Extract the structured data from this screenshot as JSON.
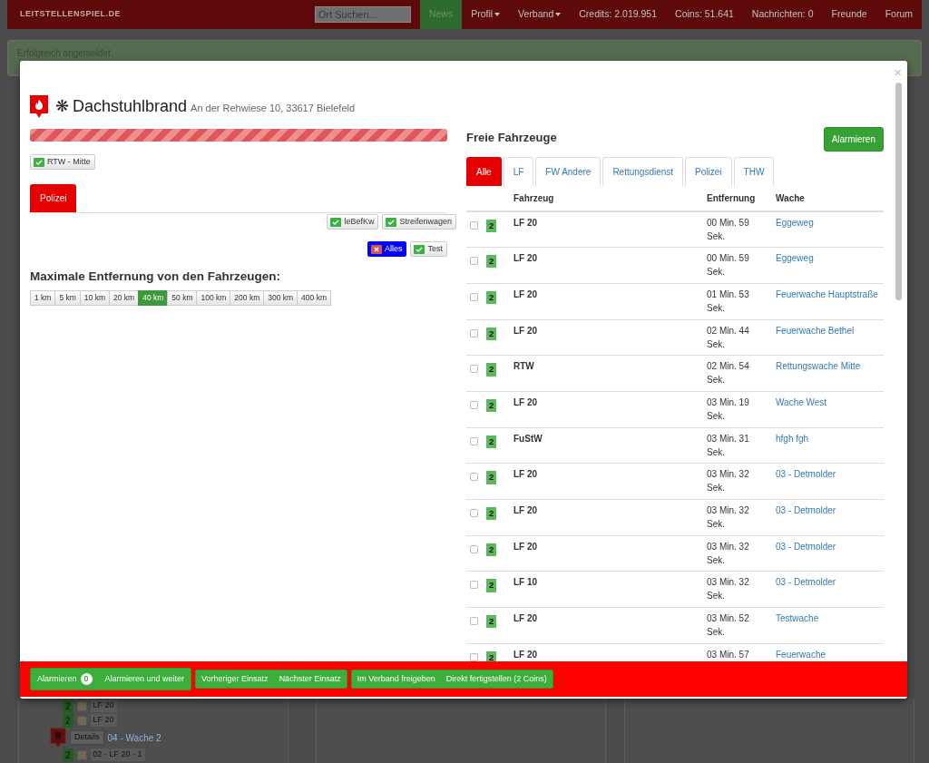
{
  "navbar": {
    "brand": "LEITSTELLENSPIEL.DE",
    "search": {
      "placeholder": "Ort Suchen..."
    },
    "items": [
      {
        "label": "News",
        "selected": true,
        "dropdown": false
      },
      {
        "label": "Profil",
        "selected": false,
        "dropdown": true
      },
      {
        "label": "Verband",
        "selected": false,
        "dropdown": true
      },
      {
        "label": "Credits: 2.019.951",
        "selected": false,
        "dropdown": false
      },
      {
        "label": "Coins: 51.641",
        "selected": false,
        "dropdown": false
      },
      {
        "label": "Nachrichten: 0",
        "selected": false,
        "dropdown": false
      },
      {
        "label": "Freunde",
        "selected": false,
        "dropdown": false
      },
      {
        "label": "Forum",
        "selected": false,
        "dropdown": false
      }
    ]
  },
  "alert": "Erfolgreich angemeldet",
  "background_list": [
    {
      "kind": "vehicle",
      "badge": "2",
      "label": "LF 20"
    },
    {
      "kind": "vehicle",
      "badge": "2",
      "label": "LF 20"
    },
    {
      "kind": "station",
      "button": "Details",
      "label": "04 - Wache 2"
    },
    {
      "kind": "vehicle",
      "badge": "2",
      "label": "02 - LF 20 - 1"
    }
  ],
  "modal": {
    "close": "×",
    "mission": {
      "symbol": "❋",
      "title": "Dachstuhlbrand",
      "address": "An der Rehwiese 10, 33617 Bielefeld",
      "level": 1
    },
    "assigned": [
      {
        "label": "RTW - Mitte",
        "checked": true
      }
    ],
    "requirement_tabs": [
      {
        "label": "Polizei",
        "selected": true
      }
    ],
    "filter_rows": [
      [
        {
          "label": "leBefKw",
          "checked": true,
          "highlighted": false
        },
        {
          "label": "Streifenwagen",
          "checked": true,
          "highlighted": false
        }
      ],
      [
        {
          "label": "Alles",
          "checked": false,
          "highlighted": true
        },
        {
          "label": "Test",
          "checked": true,
          "highlighted": false
        }
      ]
    ],
    "distance": {
      "heading": "Maximale Entfernung von den Fahrzeugen:",
      "options": [
        {
          "label": "1 km",
          "selected": false
        },
        {
          "label": "5 km",
          "selected": false
        },
        {
          "label": "10 km",
          "selected": false
        },
        {
          "label": "20 km",
          "selected": false
        },
        {
          "label": "40 km",
          "selected": true
        },
        {
          "label": "50 km",
          "selected": false
        },
        {
          "label": "100 km",
          "selected": false
        },
        {
          "label": "200 km",
          "selected": false
        },
        {
          "label": "300 km",
          "selected": false
        },
        {
          "label": "400 km",
          "selected": false
        }
      ]
    },
    "vehicles": {
      "heading": "Freie Fahrzeuge",
      "alarm_button": "Alarmieren",
      "tabs": [
        {
          "label": "Alle",
          "selected": true
        },
        {
          "label": "LF",
          "selected": false
        },
        {
          "label": "FW Andere",
          "selected": false
        },
        {
          "label": "Rettungsdienst",
          "selected": false
        },
        {
          "label": "Polizei",
          "selected": false
        },
        {
          "label": "THW",
          "selected": false
        }
      ],
      "columns": [
        "Fahrzeug",
        "Entfernung",
        "Wache"
      ],
      "rows": [
        {
          "checked": false,
          "badge": "2",
          "vehicle": "LF 20",
          "distance": "00 Min. 59 Sek.",
          "station": "Eggeweg"
        },
        {
          "checked": false,
          "badge": "2",
          "vehicle": "LF 20",
          "distance": "00 Min. 59 Sek.",
          "station": "Eggeweg"
        },
        {
          "checked": false,
          "badge": "2",
          "vehicle": "LF 20",
          "distance": "01 Min. 53 Sek.",
          "station": "Feuerwache Hauptstraße"
        },
        {
          "checked": false,
          "badge": "2",
          "vehicle": "LF 20",
          "distance": "02 Min. 44 Sek.",
          "station": "Feuerwache Bethel"
        },
        {
          "checked": false,
          "badge": "2",
          "vehicle": "RTW",
          "distance": "02 Min. 54 Sek.",
          "station": "Rettungswache Mitte"
        },
        {
          "checked": false,
          "badge": "2",
          "vehicle": "LF 20",
          "distance": "03 Min. 19 Sek.",
          "station": "Wache West"
        },
        {
          "checked": false,
          "badge": "2",
          "vehicle": "FuStW",
          "distance": "03 Min. 31 Sek.",
          "station": "hfgh fgh"
        },
        {
          "checked": false,
          "badge": "2",
          "vehicle": "LF 20",
          "distance": "03 Min. 32 Sek.",
          "station": "03 - Detmolder"
        },
        {
          "checked": false,
          "badge": "2",
          "vehicle": "LF 20",
          "distance": "03 Min. 32 Sek.",
          "station": "03 - Detmolder"
        },
        {
          "checked": false,
          "badge": "2",
          "vehicle": "LF 20",
          "distance": "03 Min. 32 Sek.",
          "station": "03 - Detmolder"
        },
        {
          "checked": false,
          "badge": "2",
          "vehicle": "LF 10",
          "distance": "03 Min. 32 Sek.",
          "station": "03 - Detmolder"
        },
        {
          "checked": false,
          "badge": "2",
          "vehicle": "LF 20",
          "distance": "03 Min. 52 Sek.",
          "station": "Testwache"
        },
        {
          "checked": false,
          "badge": "2",
          "vehicle": "LF 20",
          "distance": "03 Min. 57",
          "station": "Feuerwache"
        }
      ]
    },
    "footer": [
      [
        {
          "label": "Alarmieren",
          "badge": "0"
        },
        {
          "label": "Alarmieren und weiter"
        }
      ],
      [
        {
          "label": "Vorheriger Einsatz"
        },
        {
          "label": "Nächster Einsatz"
        }
      ],
      [
        {
          "label": "Im Verband freigeben"
        },
        {
          "label": "Direkt fertigstellen (2 Coins)"
        }
      ]
    ]
  }
}
